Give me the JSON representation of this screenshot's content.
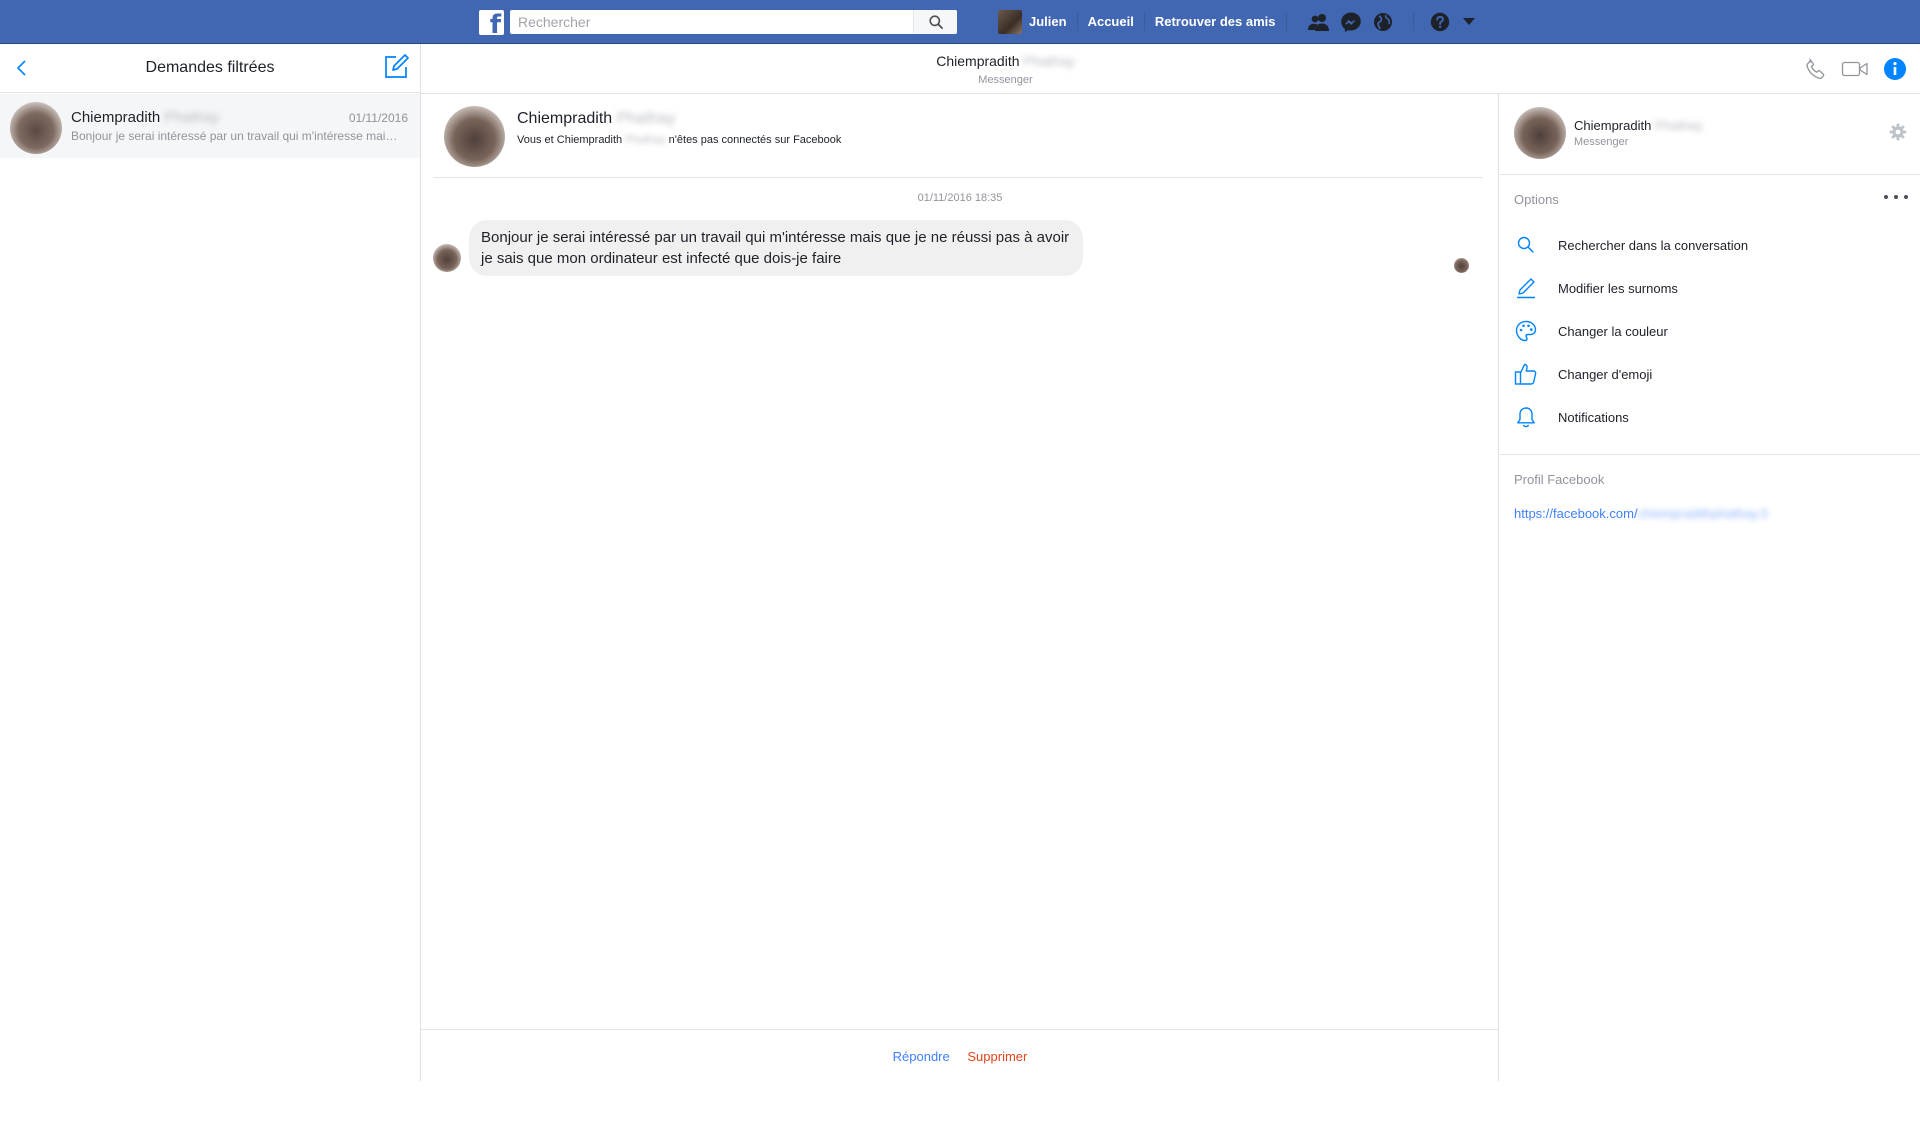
{
  "topbar": {
    "logo_letter": "f",
    "search_placeholder": "Rechercher",
    "user_name": "Julien",
    "nav_home": "Accueil",
    "nav_find_friends": "Retrouver des amis",
    "icons": [
      "friends-icon",
      "messenger-icon",
      "globe-icon",
      "help-icon",
      "dropdown-icon"
    ]
  },
  "left": {
    "title": "Demandes filtrées",
    "threads": [
      {
        "first_name": "Chiempradith",
        "last_name_blurred": "Phathay",
        "date": "01/11/2016",
        "snippet": "Bonjour je serai intéressé par un travail qui m'intéresse mais que je ne réussi pas à avoir"
      }
    ]
  },
  "conversation": {
    "header_first_name": "Chiempradith",
    "header_last_name_blurred": "Phathay",
    "header_sub": "Messenger",
    "intro_first_name": "Chiempradith",
    "intro_last_name_blurred": "Phathay",
    "intro_sub_prefix": "Vous et Chiempradith",
    "intro_sub_blurred": "Phathay",
    "intro_sub_suffix": "n'êtes pas connectés sur Facebook",
    "timestamp": "01/11/2016 18:35",
    "message": "Bonjour je serai intéressé par un travail qui m'intéresse mais que je ne réussi pas à avoir je sais que mon ordinateur est infecté que dois-je faire",
    "reply_label": "Répondre",
    "delete_label": "Supprimer"
  },
  "right": {
    "first_name": "Chiempradith",
    "last_name_blurred": "Phathay",
    "sub": "Messenger",
    "options_title": "Options",
    "options": [
      {
        "label": "Rechercher dans la conversation",
        "icon": "search-icon"
      },
      {
        "label": "Modifier les surnoms",
        "icon": "pencil-icon"
      },
      {
        "label": "Changer la couleur",
        "icon": "palette-icon"
      },
      {
        "label": "Changer d'emoji",
        "icon": "thumbs-up-icon"
      },
      {
        "label": "Notifications",
        "icon": "bell-icon"
      }
    ],
    "profile_title": "Profil Facebook",
    "profile_url_prefix": "https://facebook.com/",
    "profile_url_blurred": "chiempradithphathay.5"
  },
  "colors": {
    "facebook_blue": "#4267b2",
    "messenger_blue": "#0084ff",
    "link_blue": "#4080ff",
    "delete_red": "#e0451d",
    "bubble_gray": "#f1f0f0"
  }
}
